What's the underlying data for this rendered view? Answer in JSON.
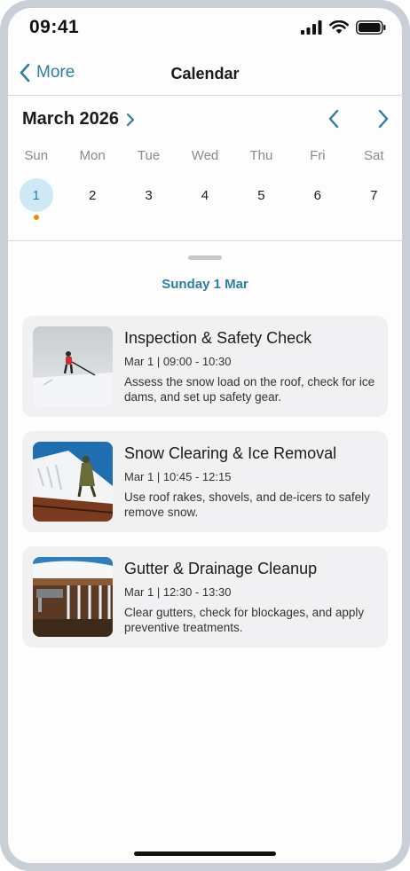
{
  "status": {
    "time": "09:41"
  },
  "nav": {
    "back_label": "More",
    "title": "Calendar"
  },
  "calendar": {
    "month_label": "March 2026",
    "weekdays": [
      "Sun",
      "Mon",
      "Tue",
      "Wed",
      "Thu",
      "Fri",
      "Sat"
    ],
    "dates": [
      "1",
      "2",
      "3",
      "4",
      "5",
      "6",
      "7"
    ],
    "selected_index": 0
  },
  "day": {
    "title": "Sunday 1 Mar"
  },
  "events": [
    {
      "title": "Inspection & Safety Check",
      "time": "Mar 1 | 09:00 - 10:30",
      "description": "Assess the snow load on the roof, check for ice dams, and set up safety gear."
    },
    {
      "title": "Snow Clearing & Ice Removal",
      "time": "Mar 1 | 10:45 - 12:15",
      "description": "Use roof rakes, shovels, and de-icers to safely remove snow."
    },
    {
      "title": "Gutter & Drainage Cleanup",
      "time": "Mar 1 | 12:30 - 13:30",
      "description": "Clear gutters, check for blockages, and apply preventive treatments."
    }
  ],
  "colors": {
    "accent": "#2c7fa3",
    "selected_bg": "#cfe8f6",
    "event_dot": "#f08a00",
    "card_bg": "#f1f1f3"
  }
}
